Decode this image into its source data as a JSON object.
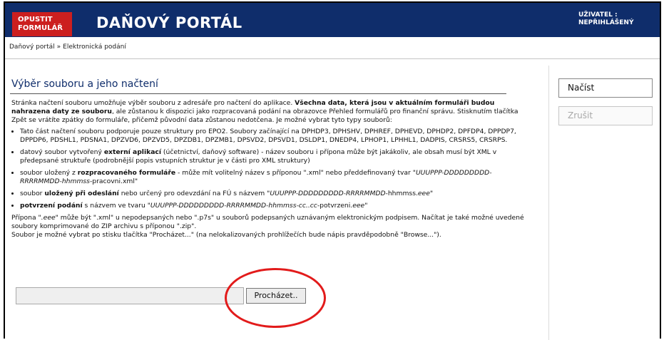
{
  "header": {
    "exit_line1": "OPUSTIT",
    "exit_line2": "FORMULÁŘ",
    "title": "DAŇOVÝ PORTÁL",
    "user_line1": "UŽIVATEL :",
    "user_line2": "NEPŘIHLÁŠENÝ"
  },
  "breadcrumb": {
    "item1": "Daňový portál",
    "sep": "»",
    "item2": "Elektronická podání"
  },
  "page": {
    "heading": "Výběr souboru a jeho načtení",
    "intro_a": "Stránka načtení souboru umožňuje výběr souboru z adresáře pro načtení do aplikace. ",
    "intro_b": "Všechna data, která jsou v aktuálním formuláři budou nahrazena daty ze souboru",
    "intro_c": ", ale zůstanou k dispozici jako rozpracovaná podání na obrazovce Přehled formulářů pro finanční správu. Stisknutím tlačítka Zpět se vrátíte zpátky do formuláře, přičemž původní data zůstanou nedotčena. Je možné vybrat tyto typy souborů:",
    "bullet1": "Tato část načtení souboru podporuje pouze struktury pro EPO2. Soubory začínající na DPHDP3, DPHSHV, DPHREF, DPHEVD, DPHDP2, DPFDP4, DPPDP7, DPPDP6, PDSHL1, PDSNA1, DPZVD6, DPZVD5, DPZDB1, DPZMB1, DPSVD2, DPSVD1, DSLDP1, DNEDP4, LPHOP1, LPHHL1, DADPIS, CRSRS5, CRSRPS.",
    "bullet2_a": "datový soubor vytvořený ",
    "bullet2_b": "externí aplikací",
    "bullet2_c": " (účetnictví, daňový software) - název souboru i přípona může být jakákoliv, ale obsah musí být XML v předepsané struktuře (podrobnější popis vstupních struktur je v části pro XML struktury)",
    "bullet3_a": "soubor uložený z ",
    "bullet3_b": "rozpracovaného formuláře",
    "bullet3_c": " - může mít volitelný název s příponou \".xml\" nebo předdefinovaný tvar \"",
    "bullet3_d": "UUUPPP-DDDDDDDDD-RRRRMMDD-hhmmss",
    "bullet3_e": "-pracovni.xml\"",
    "bullet4_a": "soubor ",
    "bullet4_b": "uložený při odeslání",
    "bullet4_c": " nebo určený pro odevzdání na FÚ s názvem \"",
    "bullet4_d": "UUUPPP-DDDDDDDDD-RRRRMMDD",
    "bullet4_e": "-hhmmss.",
    "bullet4_f": "eee",
    "bullet4_g": "\"",
    "bullet5_a": "potvrzení podání",
    "bullet5_b": " s názvem ve tvaru \"",
    "bullet5_c": "UUUPPP-DDDDDDDDD-RRRRMMDD-hhmmss-cc..cc",
    "bullet5_d": "-potvrzeni.",
    "bullet5_e": "eee",
    "bullet5_f": "\"",
    "note1_a": "Přípona \"",
    "note1_b": ".eee",
    "note1_c": "\" může být \".xml\" u nepodepsaných nebo \".p7s\" u souborů podepsaných uznávaným elektronickým podpisem. Načítat je také možné uvedené soubory komprimované do ZIP archivu s příponou \".zip\".",
    "note2": "Soubor je možné vybrat po stisku tlačítka \"Procházet...\" (na nelokalizovaných prohlížečích bude nápis pravděpodobně \"Browse...\").",
    "browse_label": "Procházet..",
    "file_value": ""
  },
  "sidebar": {
    "load_label": "Načíst",
    "cancel_label": "Zrušit"
  },
  "colors": {
    "brand": "#0f2d6b",
    "exit": "#cc1f1f",
    "annotation": "#e21b1b"
  }
}
